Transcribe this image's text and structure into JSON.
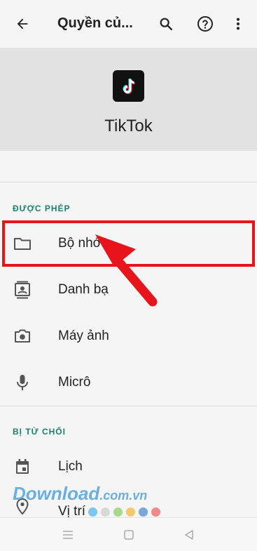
{
  "appbar": {
    "title": "Quyền củ...",
    "back_icon": "arrow-left-icon",
    "search_icon": "search-icon",
    "help_icon": "help-circle-icon",
    "more_icon": "more-vertical-icon"
  },
  "app": {
    "name": "TikTok",
    "icon": "tiktok-logo-icon"
  },
  "sections": {
    "allowed": {
      "label": "ĐƯỢC PHÉP",
      "items": [
        {
          "label": "Bộ nhớ",
          "icon": "folder-icon"
        },
        {
          "label": "Danh bạ",
          "icon": "contacts-icon"
        },
        {
          "label": "Máy ảnh",
          "icon": "camera-icon"
        },
        {
          "label": "Micrô",
          "icon": "microphone-icon"
        }
      ]
    },
    "denied": {
      "label": "BỊ TỪ CHỐI",
      "items": [
        {
          "label": "Lịch",
          "icon": "calendar-icon"
        },
        {
          "label": "Vị trí",
          "icon": "location-icon"
        }
      ]
    }
  },
  "watermark": {
    "text": "Download",
    "suffix": ".com.vn",
    "dot_colors": [
      "#7ec8f0",
      "#d8d8d8",
      "#a8d88a",
      "#f5c96a",
      "#7aa6d8",
      "#f08a8a"
    ]
  },
  "annotation": {
    "highlight_color": "#e8141c"
  },
  "navbar": {
    "recent_icon": "menu-lines-icon",
    "home_icon": "square-icon",
    "back_icon": "triangle-back-icon"
  },
  "colors": {
    "accent": "#1a7f6e",
    "header_bg": "#e2e2e2",
    "page_bg": "#f5f5f5"
  }
}
